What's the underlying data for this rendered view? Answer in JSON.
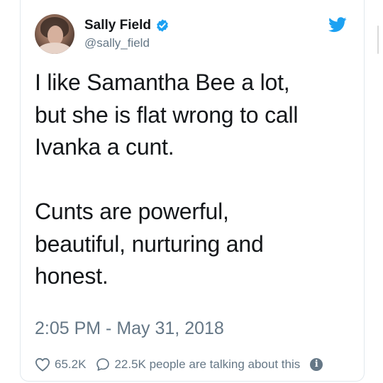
{
  "author": {
    "display_name": "Sally Field",
    "handle": "@sally_field",
    "verified": true
  },
  "tweet": {
    "text": "I like Samantha Bee a lot,\nbut she is flat wrong to call\nIvanka a cunt.\n\nCunts are powerful,\nbeautiful, nurturing and\nhonest.",
    "timestamp": "2:05 PM - May 31, 2018"
  },
  "engagement": {
    "likes": "65.2K",
    "conversation": "22.5K people are talking about this"
  },
  "icons": {
    "verified": "verified-badge-icon",
    "brand": "twitter-bird-icon",
    "like": "heart-icon",
    "reply": "speech-bubble-icon",
    "info": "info-icon"
  },
  "colors": {
    "twitter_blue": "#1da1f2",
    "text": "#14171a",
    "muted": "#657786",
    "border": "#e1e8ed"
  }
}
